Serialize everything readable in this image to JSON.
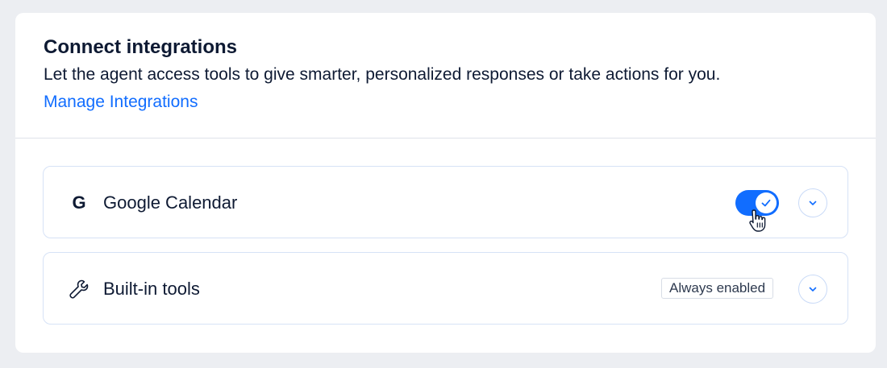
{
  "header": {
    "title": "Connect integrations",
    "description": "Let the agent access tools to give smarter, personalized responses or take actions for you.",
    "manage_link": "Manage Integrations"
  },
  "integrations": [
    {
      "icon": "google-icon",
      "icon_text": "G",
      "label": "Google Calendar",
      "control": "toggle",
      "enabled": true
    },
    {
      "icon": "wrench-icon",
      "label": "Built-in tools",
      "control": "badge",
      "badge": "Always enabled"
    }
  ],
  "colors": {
    "accent": "#116dff",
    "background": "#eceef2",
    "text": "#0e1a33",
    "row_border": "#d6e2f6"
  }
}
